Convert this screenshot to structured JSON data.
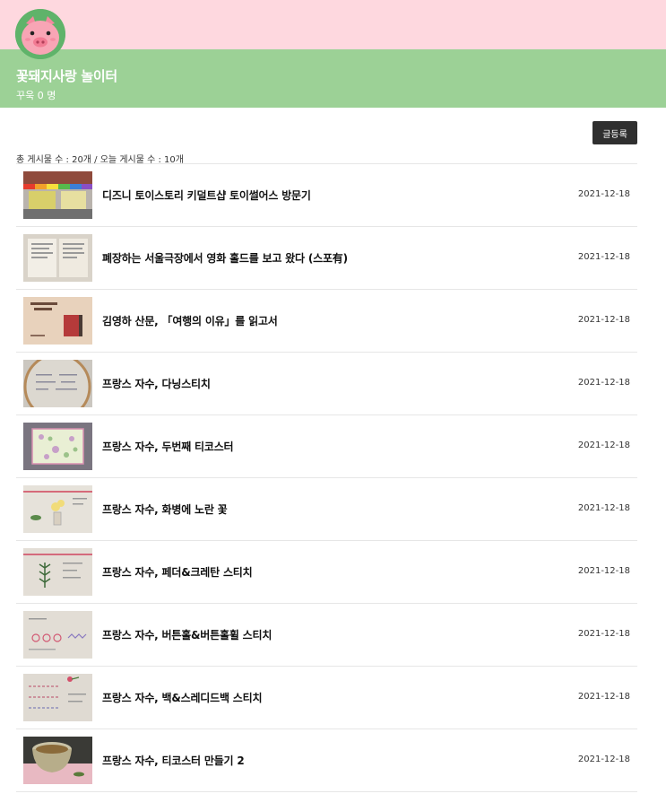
{
  "header": {
    "cafe_name": "꽃돼지사랑 놀이터",
    "member_label": "꾸욱 0 명",
    "colors": {
      "top_band": "#fed8df",
      "title_band": "#9cd196",
      "pig": "#f8a5b5"
    }
  },
  "toolbar": {
    "write_label": "글등록",
    "stats_text": "총 게시물 수 : 20개 / 오늘 게시물 수 : 10개"
  },
  "posts": [
    {
      "title": "디즈니 토이스토리 키덜트샵 토이썰어스 방문기",
      "date": "2021-12-18",
      "thumb_icon": "storefront-photo"
    },
    {
      "title": "폐장하는 서울극장에서 영화 홀드를 보고 왔다 (스포有)",
      "date": "2021-12-18",
      "thumb_icon": "ticket-photo"
    },
    {
      "title": "김영하 산문, 「여행의 이유」를 읽고서",
      "date": "2021-12-18",
      "thumb_icon": "book-photo"
    },
    {
      "title": "프랑스 자수, 다닝스티치",
      "date": "2021-12-18",
      "thumb_icon": "embroidery-hoop-photo"
    },
    {
      "title": "프랑스 자수, 두번째 티코스터",
      "date": "2021-12-18",
      "thumb_icon": "coaster-photo"
    },
    {
      "title": "프랑스 자수, 화병에 노란 꽃",
      "date": "2021-12-18",
      "thumb_icon": "flower-embroidery-photo"
    },
    {
      "title": "프랑스 자수, 페더&크레탄 스티치",
      "date": "2021-12-18",
      "thumb_icon": "stitch-sample-photo"
    },
    {
      "title": "프랑스 자수, 버튼홀&버튼홀휠 스티치",
      "date": "2021-12-18",
      "thumb_icon": "stitch-sample-photo"
    },
    {
      "title": "프랑스 자수, 백&스레디드백 스티치",
      "date": "2021-12-18",
      "thumb_icon": "stitch-sample-photo"
    },
    {
      "title": "프랑스 자수, 티코스터 만들기 2",
      "date": "2021-12-18",
      "thumb_icon": "teacup-photo"
    }
  ]
}
